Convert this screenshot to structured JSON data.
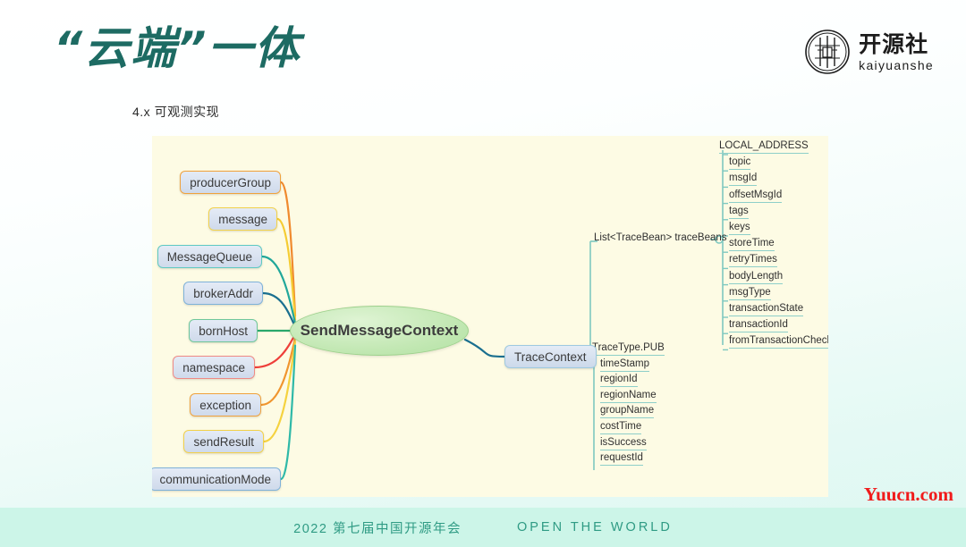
{
  "header": {
    "title": "“云端”一体",
    "subtitle": "4.x 可观测实现"
  },
  "logo": {
    "icon": "kaiyuanshe-seal-icon",
    "cn": "开源社",
    "en": "kaiyuanshe"
  },
  "mindmap": {
    "center": {
      "label": "SendMessageContext"
    },
    "trace_context": {
      "label": "TraceContext"
    },
    "left_nodes": [
      {
        "label": "producerGroup",
        "border": "#f0a23c",
        "line": "#f08a2e"
      },
      {
        "label": "message",
        "border": "#f2d14a",
        "line": "#f5cc33"
      },
      {
        "label": "MessageQueue",
        "border": "#5fc9c2",
        "line": "#21a79a"
      },
      {
        "label": "brokerAddr",
        "border": "#7fb2d9",
        "line": "#1a6f8f"
      },
      {
        "label": "bornHost",
        "border": "#6fc79a",
        "line": "#2aa86b"
      },
      {
        "label": "namespace",
        "border": "#ef8a85",
        "line": "#ee3f3a"
      },
      {
        "label": "exception",
        "border": "#f0a23c",
        "line": "#f0952e"
      },
      {
        "label": "sendResult",
        "border": "#f2d14a",
        "line": "#f5d23f"
      },
      {
        "label": "communicationMode",
        "border": "#7fb2d9",
        "line": "#2fb9a8"
      }
    ],
    "trace_beans_label": "List<TraceBean> traceBeans",
    "trace_bean_fields": [
      "LOCAL_ADDRESS",
      "topic",
      "msgId",
      "offsetMsgId",
      "tags",
      "keys",
      "storeTime",
      "retryTimes",
      "bodyLength",
      "msgType",
      "transactionState",
      "transactionId",
      "fromTransactionCheck"
    ],
    "trace_context_fields": [
      "TraceType.PUB",
      "timeStamp",
      "regionId",
      "regionName",
      "groupName",
      "costTime",
      "isSuccess",
      "requestId"
    ]
  },
  "footer": {
    "cn": "2022 第七届中国开源年会",
    "en": "OPEN THE WORLD"
  },
  "watermark": {
    "text": "Yuucn.com"
  }
}
